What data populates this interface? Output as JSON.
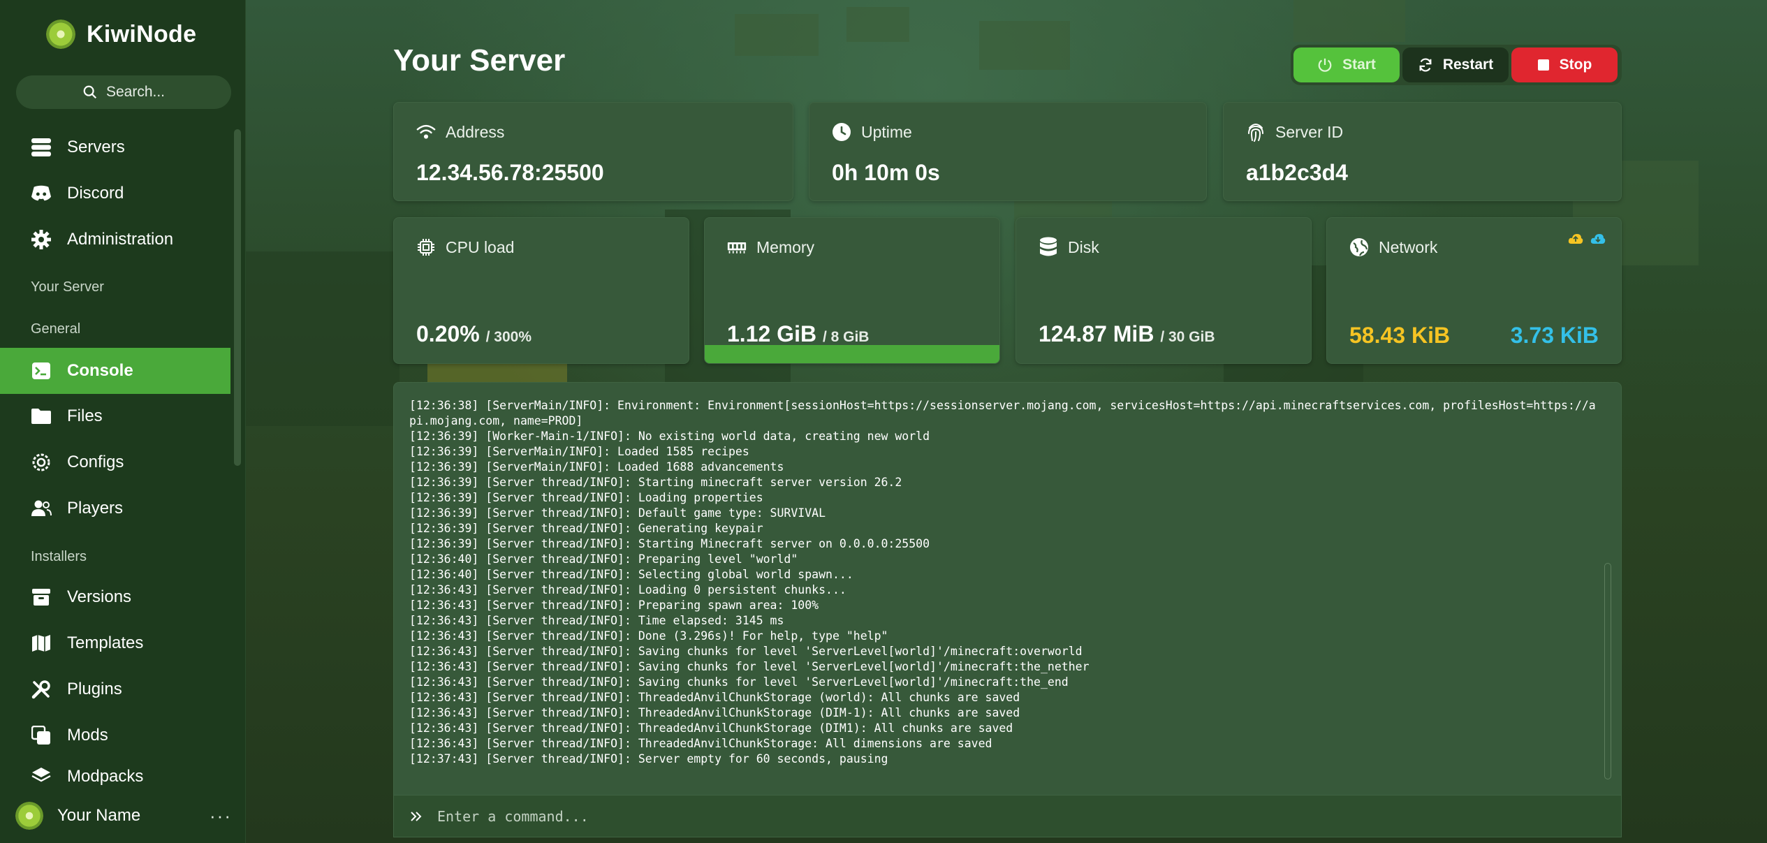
{
  "brand": {
    "name": "KiwiNode"
  },
  "search": {
    "placeholder": "Search..."
  },
  "nav": {
    "top": [
      {
        "label": "Servers",
        "icon": "server-icon"
      },
      {
        "label": "Discord",
        "icon": "discord-icon"
      },
      {
        "label": "Administration",
        "icon": "gear-icon"
      }
    ],
    "section_server": "Your Server",
    "section_general": "General",
    "general": [
      {
        "label": "Console",
        "icon": "terminal-icon",
        "active": true
      },
      {
        "label": "Files",
        "icon": "folder-icon"
      },
      {
        "label": "Configs",
        "icon": "cog-icon"
      },
      {
        "label": "Players",
        "icon": "users-icon"
      }
    ],
    "section_installers": "Installers",
    "installers": [
      {
        "label": "Versions",
        "icon": "archive-icon"
      },
      {
        "label": "Templates",
        "icon": "map-icon"
      },
      {
        "label": "Plugins",
        "icon": "tools-icon"
      },
      {
        "label": "Mods",
        "icon": "clone-icon"
      },
      {
        "label": "Modpacks",
        "icon": "layers-icon"
      }
    ]
  },
  "user": {
    "name": "Your Name",
    "more": "···"
  },
  "header": {
    "title": "Your Server"
  },
  "power": {
    "start": "Start",
    "restart": "Restart",
    "stop": "Stop"
  },
  "stats": {
    "address": {
      "label": "Address",
      "value": "12.34.56.78:25500"
    },
    "uptime": {
      "label": "Uptime",
      "value": "0h 10m 0s"
    },
    "server_id": {
      "label": "Server ID",
      "value": "a1b2c3d4"
    },
    "cpu": {
      "label": "CPU load",
      "value": "0.20%",
      "limit": "/ 300%"
    },
    "memory": {
      "label": "Memory",
      "value": "1.12 GiB",
      "limit": "/ 8 GiB",
      "fill": 1.0
    },
    "disk": {
      "label": "Disk",
      "value": "124.87 MiB",
      "limit": "/ 30 GiB"
    },
    "network": {
      "label": "Network",
      "upload": "58.43 KiB",
      "download": "3.73 KiB"
    }
  },
  "colors": {
    "accent": "#4aa93a",
    "stop": "#e0262f",
    "upload": "#f6c423",
    "download": "#34c0e8"
  },
  "console": {
    "lines": [
      "[12:36:38] [ServerMain/INFO]: Environment: Environment[sessionHost=https://sessionserver.mojang.com, servicesHost=https://api.minecraftservices.com, profilesHost=https://api.mojang.com, name=PROD]",
      "[12:36:39] [Worker-Main-1/INFO]: No existing world data, creating new world",
      "[12:36:39] [ServerMain/INFO]: Loaded 1585 recipes",
      "[12:36:39] [ServerMain/INFO]: Loaded 1688 advancements",
      "[12:36:39] [Server thread/INFO]: Starting minecraft server version 26.2",
      "[12:36:39] [Server thread/INFO]: Loading properties",
      "[12:36:39] [Server thread/INFO]: Default game type: SURVIVAL",
      "[12:36:39] [Server thread/INFO]: Generating keypair",
      "[12:36:39] [Server thread/INFO]: Starting Minecraft server on 0.0.0.0:25500",
      "[12:36:40] [Server thread/INFO]: Preparing level \"world\"",
      "[12:36:40] [Server thread/INFO]: Selecting global world spawn...",
      "[12:36:43] [Server thread/INFO]: Loading 0 persistent chunks...",
      "[12:36:43] [Server thread/INFO]: Preparing spawn area: 100%",
      "[12:36:43] [Server thread/INFO]: Time elapsed: 3145 ms",
      "[12:36:43] [Server thread/INFO]: Done (3.296s)! For help, type \"help\"",
      "[12:36:43] [Server thread/INFO]: Saving chunks for level 'ServerLevel[world]'/minecraft:overworld",
      "[12:36:43] [Server thread/INFO]: Saving chunks for level 'ServerLevel[world]'/minecraft:the_nether",
      "[12:36:43] [Server thread/INFO]: Saving chunks for level 'ServerLevel[world]'/minecraft:the_end",
      "[12:36:43] [Server thread/INFO]: ThreadedAnvilChunkStorage (world): All chunks are saved",
      "[12:36:43] [Server thread/INFO]: ThreadedAnvilChunkStorage (DIM-1): All chunks are saved",
      "[12:36:43] [Server thread/INFO]: ThreadedAnvilChunkStorage (DIM1): All chunks are saved",
      "[12:36:43] [Server thread/INFO]: ThreadedAnvilChunkStorage: All dimensions are saved",
      "[12:37:43] [Server thread/INFO]: Server empty for 60 seconds, pausing"
    ],
    "command_placeholder": "Enter a command..."
  }
}
